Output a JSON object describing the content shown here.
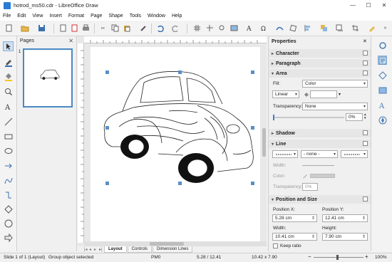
{
  "window": {
    "title": "hotrod_ms50.cdr - LibreOffice Draw",
    "minimize": "—",
    "maximize": "☐",
    "close": "✕"
  },
  "menu": [
    {
      "label": "File"
    },
    {
      "label": "Edit"
    },
    {
      "label": "View"
    },
    {
      "label": "Insert"
    },
    {
      "label": "Format"
    },
    {
      "label": "Page"
    },
    {
      "label": "Shape"
    },
    {
      "label": "Tools"
    },
    {
      "label": "Window"
    },
    {
      "label": "Help"
    }
  ],
  "pages_pane": {
    "title": "Pages",
    "close": "✕",
    "page_number": "1"
  },
  "tabs": [
    {
      "label": "Layout"
    },
    {
      "label": "Controls"
    },
    {
      "label": "Dimension Lines"
    }
  ],
  "properties": {
    "title": "Properties",
    "character": "Character",
    "paragraph": "Paragraph",
    "area": "Area",
    "fill_label": "Fill:",
    "fill_value": "Color",
    "gradient_value": "Linear",
    "transparency_label": "Transparency:",
    "transparency_value": "None",
    "transparency_pct": "0%",
    "shadow": "Shadow",
    "line": "Line",
    "line_style": "- none -",
    "width_label": "Width:",
    "color_label": "Color:",
    "line_transparency_label": "Transparency:",
    "line_transparency_pct": "0%",
    "position_size": "Position and Size",
    "pos_x_label": "Position X:",
    "pos_x": "5.28 cm",
    "pos_y_label": "Position Y:",
    "pos_y": "12.41 cm",
    "width_size_label": "Width:",
    "width_size": "10.41 cm",
    "height_label": "Height:",
    "height_size": "7.90 cm",
    "keep_ratio": "Keep ratio"
  },
  "status": {
    "slide": "Slide 1 of 1 (Layout)",
    "selection": "Group object selected",
    "master": "PM0",
    "position": "5.28 / 12.41",
    "size": "10.42 x 7.90",
    "zoom": "100%"
  },
  "colors": {
    "accent": "#4a88c6",
    "handle": "#5b8fc7"
  },
  "icons": [
    "select-icon",
    "line-color-icon",
    "fill-color-icon",
    "zoom-icon",
    "text-icon",
    "line-icon",
    "rect-icon",
    "ellipse-icon",
    "arrow-icon",
    "curve-icon",
    "connector-icon",
    "shapes-icon"
  ]
}
